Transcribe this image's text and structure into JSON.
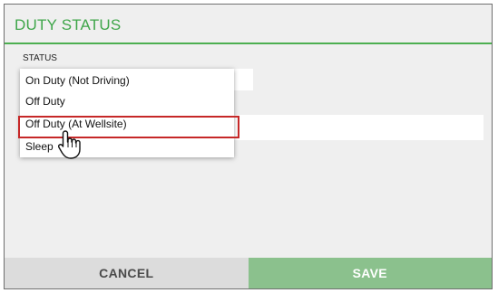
{
  "dialog": {
    "title": "DUTY STATUS",
    "status_label": "STATUS",
    "options": [
      "On Duty (Not Driving)",
      "Off Duty",
      "Off Duty (At Wellsite)",
      "Sleep"
    ],
    "cancel_label": "CANCEL",
    "save_label": "SAVE"
  },
  "colors": {
    "accent_green": "#3fa64a",
    "save_button": "#8bc18d",
    "highlight_border": "#c62828"
  },
  "icons": {
    "cursor": "hand-pointer-icon"
  }
}
